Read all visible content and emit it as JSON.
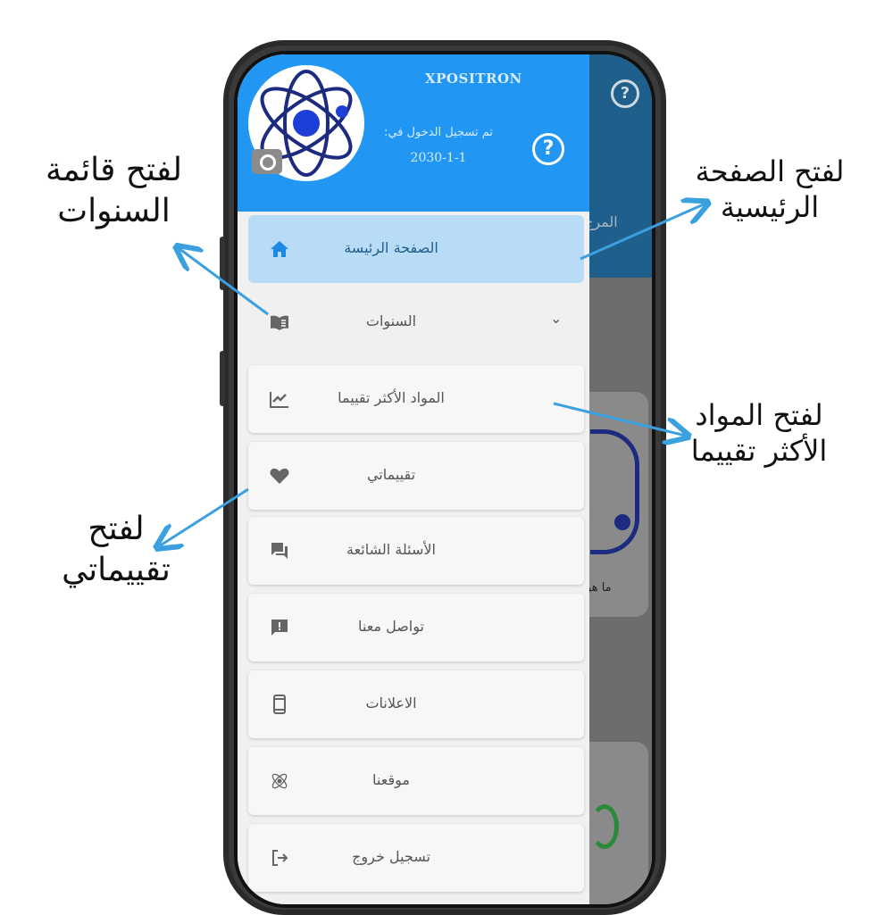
{
  "app": {
    "name": "XPOSITRON",
    "login_label": "تم تسجيل الدخول في:",
    "login_date": "2030-1-1"
  },
  "background_app": {
    "side_label": "المرج",
    "card_text": "ما هو"
  },
  "menu": [
    {
      "label": "الصفحة الرئيسة",
      "icon": "home-icon"
    },
    {
      "label": "السنوات",
      "icon": "book-icon"
    },
    {
      "label": "المواد الأكثر تقييما",
      "icon": "trending-icon"
    },
    {
      "label": "تقييماتي",
      "icon": "heart-icon"
    },
    {
      "label": "الأسئلة الشائعة",
      "icon": "forum-icon"
    },
    {
      "label": "تواصل معنا",
      "icon": "feedback-icon"
    },
    {
      "label": "الاعلانات",
      "icon": "phone-icon"
    },
    {
      "label": "موقعنا",
      "icon": "atom-icon"
    },
    {
      "label": "تسجيل خروج",
      "icon": "logout-icon"
    }
  ],
  "annotations": {
    "years": [
      "لفتح قائمة",
      "السنوات"
    ],
    "home": [
      "لفتح الصفحة",
      "الرئيسية"
    ],
    "top_rated": [
      "لفتح المواد",
      "الأكثر تقييما"
    ],
    "my_ratings": [
      "لفتح",
      "تقييماتي"
    ]
  },
  "colors": {
    "header": "#2196f3",
    "active_item": "#b8dcf6",
    "arrow": "#3aa0e0",
    "icon_blue": "#1e88e5"
  }
}
